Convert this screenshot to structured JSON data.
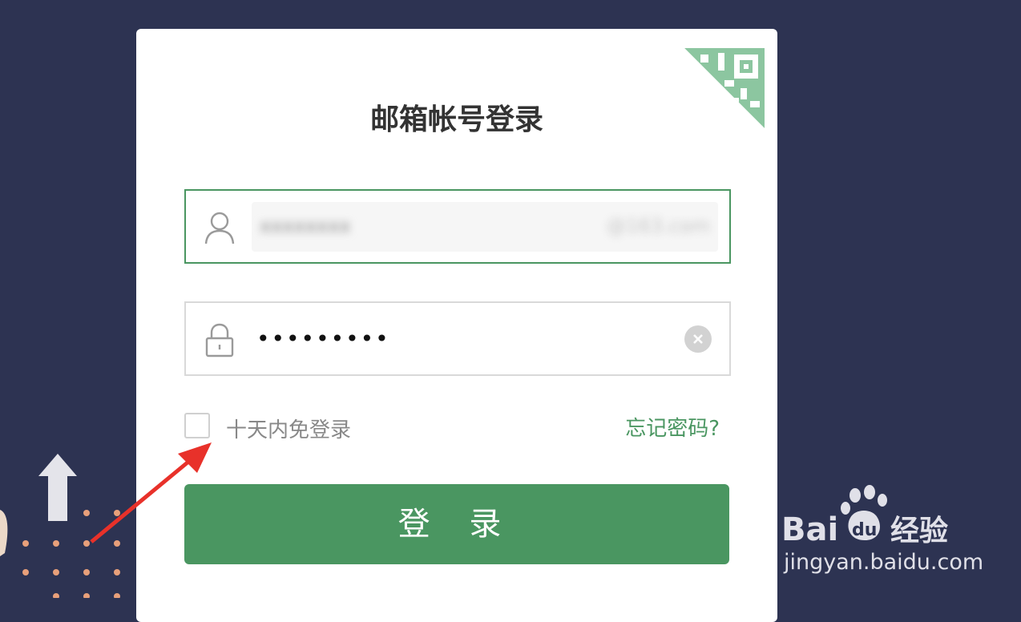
{
  "login": {
    "title": "邮箱帐号登录",
    "username_value": "xxxxxxxx",
    "username_domain": "@163.com",
    "password_mask": "•••••••••",
    "remember_label": "十天内免登录",
    "forgot_label": "忘记密码?",
    "submit_label": "登 录"
  },
  "watermark": {
    "brand": "Baidu经验",
    "url": "jingyan.baidu.com"
  },
  "colors": {
    "background": "#2d3352",
    "accent": "#4a9661",
    "annotation_arrow": "#e8312a"
  },
  "icons": [
    "qr-code-icon",
    "user-icon",
    "lock-icon",
    "clear-icon",
    "arrow-up-icon",
    "annotation-arrow"
  ]
}
